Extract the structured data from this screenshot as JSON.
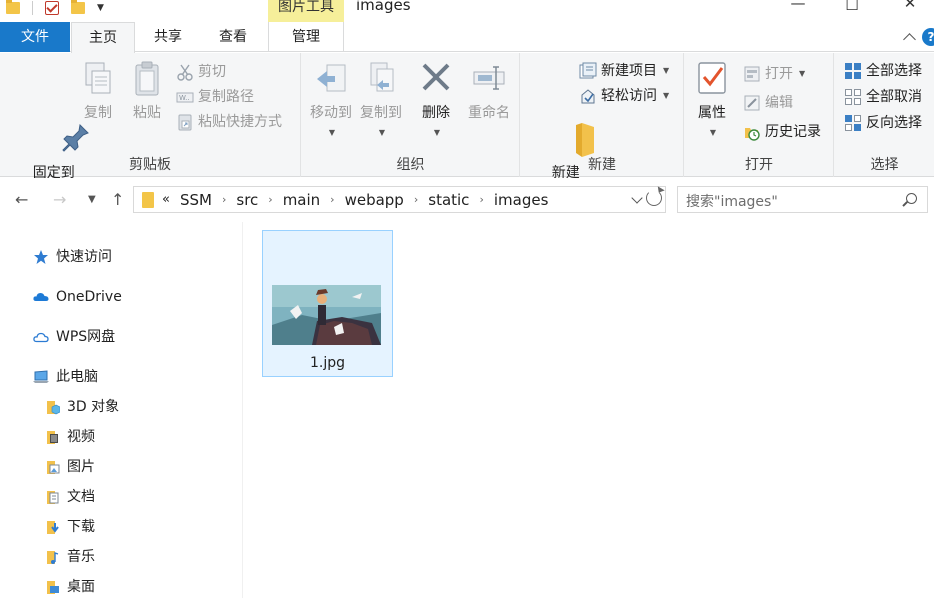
{
  "window": {
    "title": "images",
    "context_tool_label": "图片工具"
  },
  "tabs": {
    "file": "文件",
    "home": "主页",
    "share": "共享",
    "view": "查看",
    "manage": "管理"
  },
  "ribbon": {
    "clipboard": {
      "label": "剪贴板",
      "pin": "固定到\n快速访问",
      "copy": "复制",
      "paste": "粘贴",
      "cut": "剪切",
      "copy_path": "复制路径",
      "paste_shortcut": "粘贴快捷方式"
    },
    "organize": {
      "label": "组织",
      "move_to": "移动到",
      "copy_to": "复制到",
      "delete": "删除",
      "rename": "重命名"
    },
    "new": {
      "label": "新建",
      "new_folder": "新建\n文件夹",
      "new_item": "新建项目",
      "easy_access": "轻松访问"
    },
    "open": {
      "label": "打开",
      "properties": "属性",
      "open": "打开",
      "edit": "编辑",
      "history": "历史记录"
    },
    "select": {
      "label": "选择",
      "select_all": "全部选择",
      "select_none": "全部取消",
      "invert": "反向选择"
    }
  },
  "address": {
    "overflow": "«",
    "segments": [
      "SSM",
      "src",
      "main",
      "webapp",
      "static",
      "images"
    ],
    "search_placeholder": "搜索\"images\""
  },
  "nav_pane": {
    "quick_access": "快速访问",
    "onedrive": "OneDrive",
    "wps": "WPS网盘",
    "this_pc": "此电脑",
    "items": [
      "3D 对象",
      "视频",
      "图片",
      "文档",
      "下载",
      "音乐",
      "桌面"
    ]
  },
  "files": [
    {
      "name": "1.jpg"
    }
  ],
  "colors": {
    "accent": "#1979ca",
    "context_tab": "#f6ef9a",
    "ribbon_bg": "#f5f6f7",
    "selection_bg": "#e5f3ff",
    "selection_border": "#99d1ff",
    "folder": "#f3c548"
  }
}
